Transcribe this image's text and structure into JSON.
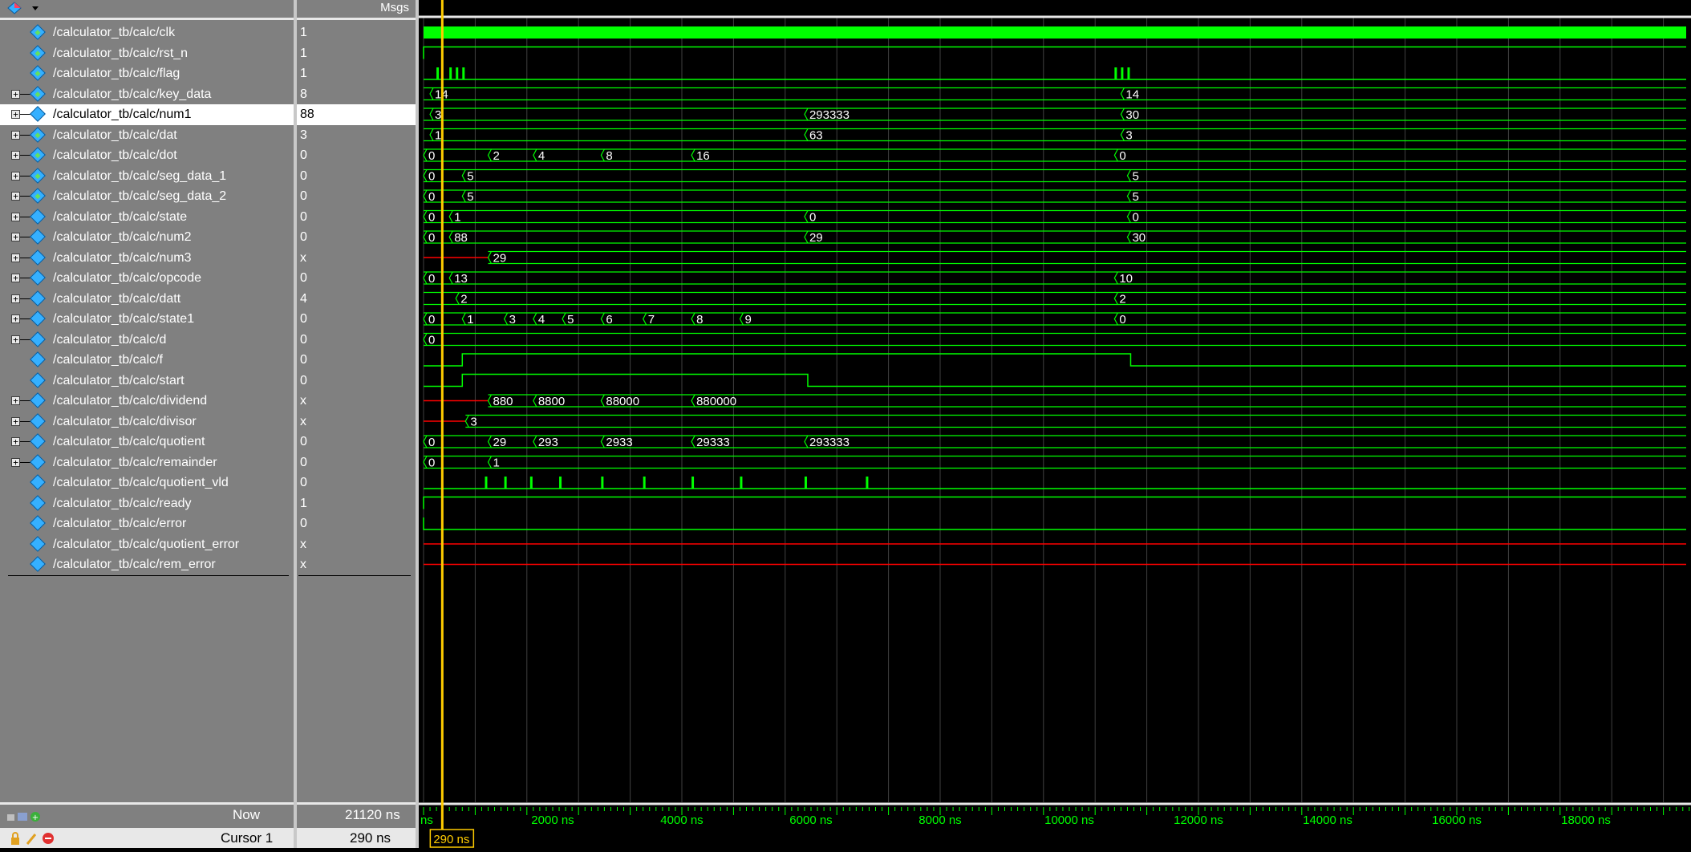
{
  "panes": {
    "msgs_label": "Msgs"
  },
  "signals": [
    {
      "name": "/calculator_tb/calc/clk",
      "value": "1",
      "expandable": false,
      "icon": "signal-icon-green"
    },
    {
      "name": "/calculator_tb/calc/rst_n",
      "value": "1",
      "expandable": false,
      "icon": "signal-icon-green"
    },
    {
      "name": "/calculator_tb/calc/flag",
      "value": "1",
      "expandable": false,
      "icon": "signal-icon-green"
    },
    {
      "name": "/calculator_tb/calc/key_data",
      "value": "8",
      "expandable": true,
      "icon": "signal-icon-green"
    },
    {
      "name": "/calculator_tb/calc/num1",
      "value": "88",
      "expandable": true,
      "icon": "signal-icon",
      "selected": true
    },
    {
      "name": "/calculator_tb/calc/dat",
      "value": "3",
      "expandable": true,
      "icon": "signal-icon-green"
    },
    {
      "name": "/calculator_tb/calc/dot",
      "value": "0",
      "expandable": true,
      "icon": "signal-icon-green"
    },
    {
      "name": "/calculator_tb/calc/seg_data_1",
      "value": "0",
      "expandable": true,
      "icon": "signal-icon-green"
    },
    {
      "name": "/calculator_tb/calc/seg_data_2",
      "value": "0",
      "expandable": true,
      "icon": "signal-icon-green"
    },
    {
      "name": "/calculator_tb/calc/state",
      "value": "0",
      "expandable": true,
      "icon": "signal-icon"
    },
    {
      "name": "/calculator_tb/calc/num2",
      "value": "0",
      "expandable": true,
      "icon": "signal-icon"
    },
    {
      "name": "/calculator_tb/calc/num3",
      "value": "x",
      "expandable": true,
      "icon": "signal-icon"
    },
    {
      "name": "/calculator_tb/calc/opcode",
      "value": "0",
      "expandable": true,
      "icon": "signal-icon"
    },
    {
      "name": "/calculator_tb/calc/datt",
      "value": "4",
      "expandable": true,
      "icon": "signal-icon"
    },
    {
      "name": "/calculator_tb/calc/state1",
      "value": "0",
      "expandable": true,
      "icon": "signal-icon"
    },
    {
      "name": "/calculator_tb/calc/d",
      "value": "0",
      "expandable": true,
      "icon": "signal-icon"
    },
    {
      "name": "/calculator_tb/calc/f",
      "value": "0",
      "expandable": false,
      "icon": "signal-icon"
    },
    {
      "name": "/calculator_tb/calc/start",
      "value": "0",
      "expandable": false,
      "icon": "signal-icon"
    },
    {
      "name": "/calculator_tb/calc/dividend",
      "value": "x",
      "expandable": true,
      "icon": "signal-icon"
    },
    {
      "name": "/calculator_tb/calc/divisor",
      "value": "x",
      "expandable": true,
      "icon": "signal-icon"
    },
    {
      "name": "/calculator_tb/calc/quotient",
      "value": "0",
      "expandable": true,
      "icon": "signal-icon"
    },
    {
      "name": "/calculator_tb/calc/remainder",
      "value": "0",
      "expandable": true,
      "icon": "signal-icon"
    },
    {
      "name": "/calculator_tb/calc/quotient_vld",
      "value": "0",
      "expandable": false,
      "icon": "signal-icon"
    },
    {
      "name": "/calculator_tb/calc/ready",
      "value": "1",
      "expandable": false,
      "icon": "signal-icon"
    },
    {
      "name": "/calculator_tb/calc/error",
      "value": "0",
      "expandable": false,
      "icon": "signal-icon"
    },
    {
      "name": "/calculator_tb/calc/quotient_error",
      "value": "x",
      "expandable": false,
      "icon": "signal-icon"
    },
    {
      "name": "/calculator_tb/calc/rem_error",
      "value": "x",
      "expandable": false,
      "icon": "signal-icon"
    }
  ],
  "bus_labels": [
    {
      "row": 3,
      "items": [
        {
          "t": 100,
          "label": "14"
        },
        {
          "t": 10800,
          "label": "14"
        }
      ]
    },
    {
      "row": 4,
      "items": [
        {
          "t": 100,
          "label": "3"
        },
        {
          "t": 5900,
          "label": "293333"
        },
        {
          "t": 10800,
          "label": "30"
        }
      ]
    },
    {
      "row": 5,
      "items": [
        {
          "t": 100,
          "label": "1"
        },
        {
          "t": 5900,
          "label": "63"
        },
        {
          "t": 10800,
          "label": "3"
        }
      ]
    },
    {
      "row": 6,
      "items": [
        {
          "t": 0,
          "label": "0"
        },
        {
          "t": 1000,
          "label": "2"
        },
        {
          "t": 1700,
          "label": "4"
        },
        {
          "t": 2750,
          "label": "8"
        },
        {
          "t": 4150,
          "label": "16"
        },
        {
          "t": 10700,
          "label": "0"
        }
      ]
    },
    {
      "row": 7,
      "items": [
        {
          "t": 0,
          "label": "0"
        },
        {
          "t": 600,
          "label": "5"
        },
        {
          "t": 10900,
          "label": "5"
        }
      ]
    },
    {
      "row": 8,
      "items": [
        {
          "t": 0,
          "label": "0"
        },
        {
          "t": 600,
          "label": "5"
        },
        {
          "t": 10900,
          "label": "5"
        }
      ]
    },
    {
      "row": 9,
      "items": [
        {
          "t": 0,
          "label": "0"
        },
        {
          "t": 400,
          "label": "1"
        },
        {
          "t": 5900,
          "label": "0"
        },
        {
          "t": 10900,
          "label": "0"
        }
      ]
    },
    {
      "row": 10,
      "items": [
        {
          "t": 0,
          "label": "0"
        },
        {
          "t": 400,
          "label": "88"
        },
        {
          "t": 5900,
          "label": "29"
        },
        {
          "t": 10900,
          "label": "30"
        }
      ]
    },
    {
      "row": 11,
      "items": [
        {
          "t": 1000,
          "label": "29"
        }
      ]
    },
    {
      "row": 12,
      "items": [
        {
          "t": 0,
          "label": "0"
        },
        {
          "t": 400,
          "label": "13"
        },
        {
          "t": 10700,
          "label": "10"
        }
      ]
    },
    {
      "row": 13,
      "items": [
        {
          "t": 500,
          "label": "2"
        },
        {
          "t": 10700,
          "label": "2"
        }
      ]
    },
    {
      "row": 14,
      "items": [
        {
          "t": 0,
          "label": "0"
        },
        {
          "t": 600,
          "label": "1"
        },
        {
          "t": 1250,
          "label": "3"
        },
        {
          "t": 1700,
          "label": "4"
        },
        {
          "t": 2150,
          "label": "5"
        },
        {
          "t": 2750,
          "label": "6"
        },
        {
          "t": 3400,
          "label": "7"
        },
        {
          "t": 4150,
          "label": "8"
        },
        {
          "t": 4900,
          "label": "9"
        },
        {
          "t": 10700,
          "label": "0"
        }
      ]
    },
    {
      "row": 15,
      "items": [
        {
          "t": 0,
          "label": "0"
        }
      ]
    },
    {
      "row": 18,
      "items": [
        {
          "t": 1000,
          "label": "880"
        },
        {
          "t": 1700,
          "label": "8800"
        },
        {
          "t": 2750,
          "label": "88000"
        },
        {
          "t": 4150,
          "label": "880000"
        }
      ]
    },
    {
      "row": 19,
      "items": [
        {
          "t": 650,
          "label": "3"
        }
      ]
    },
    {
      "row": 20,
      "items": [
        {
          "t": 0,
          "label": "0"
        },
        {
          "t": 1000,
          "label": "29"
        },
        {
          "t": 1700,
          "label": "293"
        },
        {
          "t": 2750,
          "label": "2933"
        },
        {
          "t": 4150,
          "label": "29333"
        },
        {
          "t": 5900,
          "label": "293333"
        }
      ]
    },
    {
      "row": 21,
      "items": [
        {
          "t": 0,
          "label": "0"
        },
        {
          "t": 1000,
          "label": "1"
        }
      ]
    }
  ],
  "timeline": {
    "ticks": [
      "2000 ns",
      "4000 ns",
      "6000 ns",
      "8000 ns",
      "10000 ns",
      "12000 ns",
      "14000 ns",
      "16000 ns",
      "18000 ns"
    ],
    "left_fragment": "ns",
    "cursor_time": "290 ns"
  },
  "status": {
    "now_label": "Now",
    "now_value": "21120 ns",
    "cursor_label": "Cursor 1",
    "cursor_value": "290 ns"
  },
  "colors": {
    "wave": "#00ff00",
    "undefined": "#ff0000",
    "cursor": "#ffcc00",
    "grid": "#404040"
  }
}
